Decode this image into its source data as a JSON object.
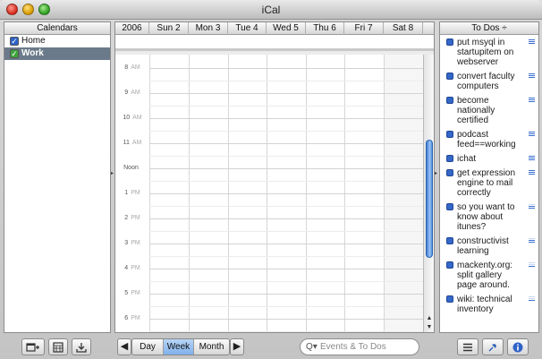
{
  "window": {
    "title": "iCal"
  },
  "calendars": {
    "header": "Calendars",
    "items": [
      {
        "label": "Home",
        "checked": true,
        "color": "#2f63c8",
        "selected": false
      },
      {
        "label": "Work",
        "checked": true,
        "color": "#3da53a",
        "selected": true
      }
    ]
  },
  "week": {
    "year": "2006",
    "days": [
      "Sun 2",
      "Mon 3",
      "Tue 4",
      "Wed 5",
      "Thu 6",
      "Fri 7",
      "Sat 8"
    ],
    "hours": [
      {
        "num": "8",
        "ampm": "AM"
      },
      {
        "num": "9",
        "ampm": "AM"
      },
      {
        "num": "10",
        "ampm": "AM"
      },
      {
        "num": "11",
        "ampm": "AM"
      },
      {
        "num": "Noon",
        "ampm": ""
      },
      {
        "num": "1",
        "ampm": "PM"
      },
      {
        "num": "2",
        "ampm": "PM"
      },
      {
        "num": "3",
        "ampm": "PM"
      },
      {
        "num": "4",
        "ampm": "PM"
      },
      {
        "num": "5",
        "ampm": "PM"
      },
      {
        "num": "6",
        "ampm": "PM"
      }
    ]
  },
  "todos": {
    "header": "To Dos ÷",
    "items": [
      {
        "text": "put msyql in startupitem on webserver",
        "priority": 3
      },
      {
        "text": "convert faculty computers",
        "priority": 3
      },
      {
        "text": "become nationally certified",
        "priority": 3
      },
      {
        "text": "podcast feed==working",
        "priority": 3
      },
      {
        "text": "ichat",
        "priority": 3
      },
      {
        "text": "get expression engine to mail correctly",
        "priority": 3
      },
      {
        "text": "so you want to know about itunes?",
        "priority": 2
      },
      {
        "text": "constructivist learning",
        "priority": 2
      },
      {
        "text": "mackenty.org: split gallery page around.",
        "priority": 1
      },
      {
        "text": "wiki: technical inventory",
        "priority": 1
      }
    ]
  },
  "toolbar": {
    "add_calendar_icon": "add-calendar-icon",
    "mini_month_icon": "mini-month-icon",
    "publish_icon": "publish-icon",
    "prev": "◀",
    "next": "▶",
    "views": [
      "Day",
      "Week",
      "Month"
    ],
    "active_view": "Week",
    "search_placeholder": "Events & To Dos",
    "list_icon": "list-icon",
    "todo_toggle_icon": "pushpin-icon",
    "info_icon": "info-icon"
  }
}
